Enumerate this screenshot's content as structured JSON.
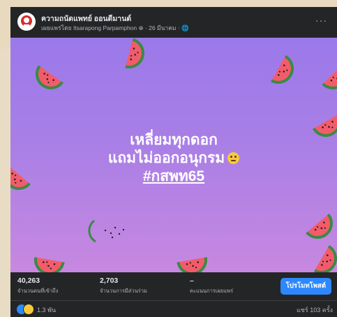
{
  "post": {
    "page_name": "ความถนัดแพทย์ ออนดีมานด์",
    "meta": "เผยแพร่โดย Itsarapong Parpamphon ⊕ · 26 มีนาคม · 🌐",
    "more_label": "···"
  },
  "image": {
    "headline_line1": "เหลี่ยมทุกดอก",
    "headline_line2": "แถมไม่ออกอนุกรม",
    "hashtag": "#กสพท65",
    "colors": {
      "bg_top": "#9b79ea",
      "bg_bottom": "#c788e0",
      "melon_flesh": "#f25c6a",
      "melon_rind": "#3a8a45"
    }
  },
  "stats": {
    "reach_value": "40,263",
    "reach_label": "จำนวนคนที่เข้าถึง",
    "engagement_value": "2,703",
    "engagement_label": "จำนวนการมีส่วนร่วม",
    "distribution_value": "–",
    "distribution_label": "คะแนนการเผยแพร่",
    "boost_label": "โปรโมทโพสต์"
  },
  "footer": {
    "reactions_count": "1.3 พัน",
    "shares": "แชร์ 103 ครั้ง"
  }
}
